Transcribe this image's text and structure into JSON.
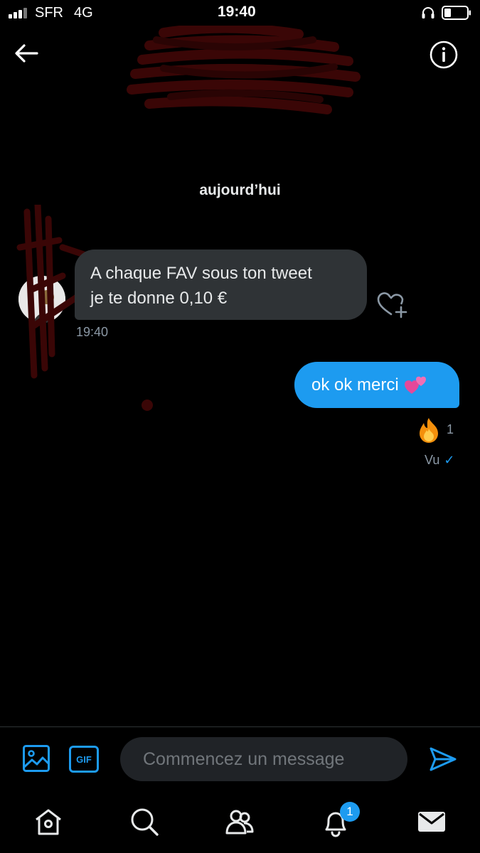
{
  "status_bar": {
    "carrier": "SFR",
    "network": "4G",
    "time": "19:40",
    "icons": [
      "signal-icon",
      "headphones-icon",
      "battery-icon"
    ]
  },
  "header": {
    "back_icon": "arrow-left-icon",
    "info_icon": "info-icon"
  },
  "conversation": {
    "date_label": "aujourd’hui",
    "messages": [
      {
        "direction": "incoming",
        "text": "A chaque FAV sous ton tweet\nje te donne 0,10 €",
        "time": "19:40"
      },
      {
        "direction": "outgoing",
        "text": "ok ok merci",
        "emoji": "two-hearts-emoji",
        "reaction_icon": "fire-emoji",
        "reaction_count": "1",
        "seen_label": "Vu",
        "seen_check": "✓"
      }
    ]
  },
  "composer": {
    "gif_label": "GIF",
    "placeholder": "Commencez un message"
  },
  "tab_bar": {
    "notifications_badge": "1",
    "tabs": [
      "home-icon",
      "search-icon",
      "communities-icon",
      "notifications-icon",
      "messages-icon"
    ]
  },
  "colors": {
    "accent": "#1d9bf0",
    "incoming_bubble": "#2f3336",
    "background": "#000000",
    "redaction": "#3a0606"
  }
}
